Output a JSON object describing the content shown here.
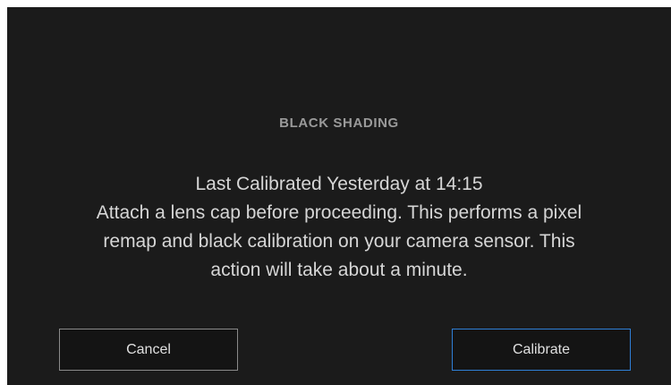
{
  "dialog": {
    "title": "BLACK SHADING",
    "last_calibrated": "Last Calibrated Yesterday at 14:15",
    "message_lines": [
      "Attach a lens cap before proceeding. This performs a pixel",
      "remap and black calibration on your camera sensor. This",
      "action will take about a minute."
    ]
  },
  "buttons": {
    "cancel_label": "Cancel",
    "calibrate_label": "Calibrate"
  },
  "colors": {
    "dialog_background": "#1b1b1b",
    "title": "#9a9a9a",
    "text": "#d6d6d6",
    "cancel_border": "#8a8a8a",
    "calibrate_border": "#2f7fd6"
  }
}
